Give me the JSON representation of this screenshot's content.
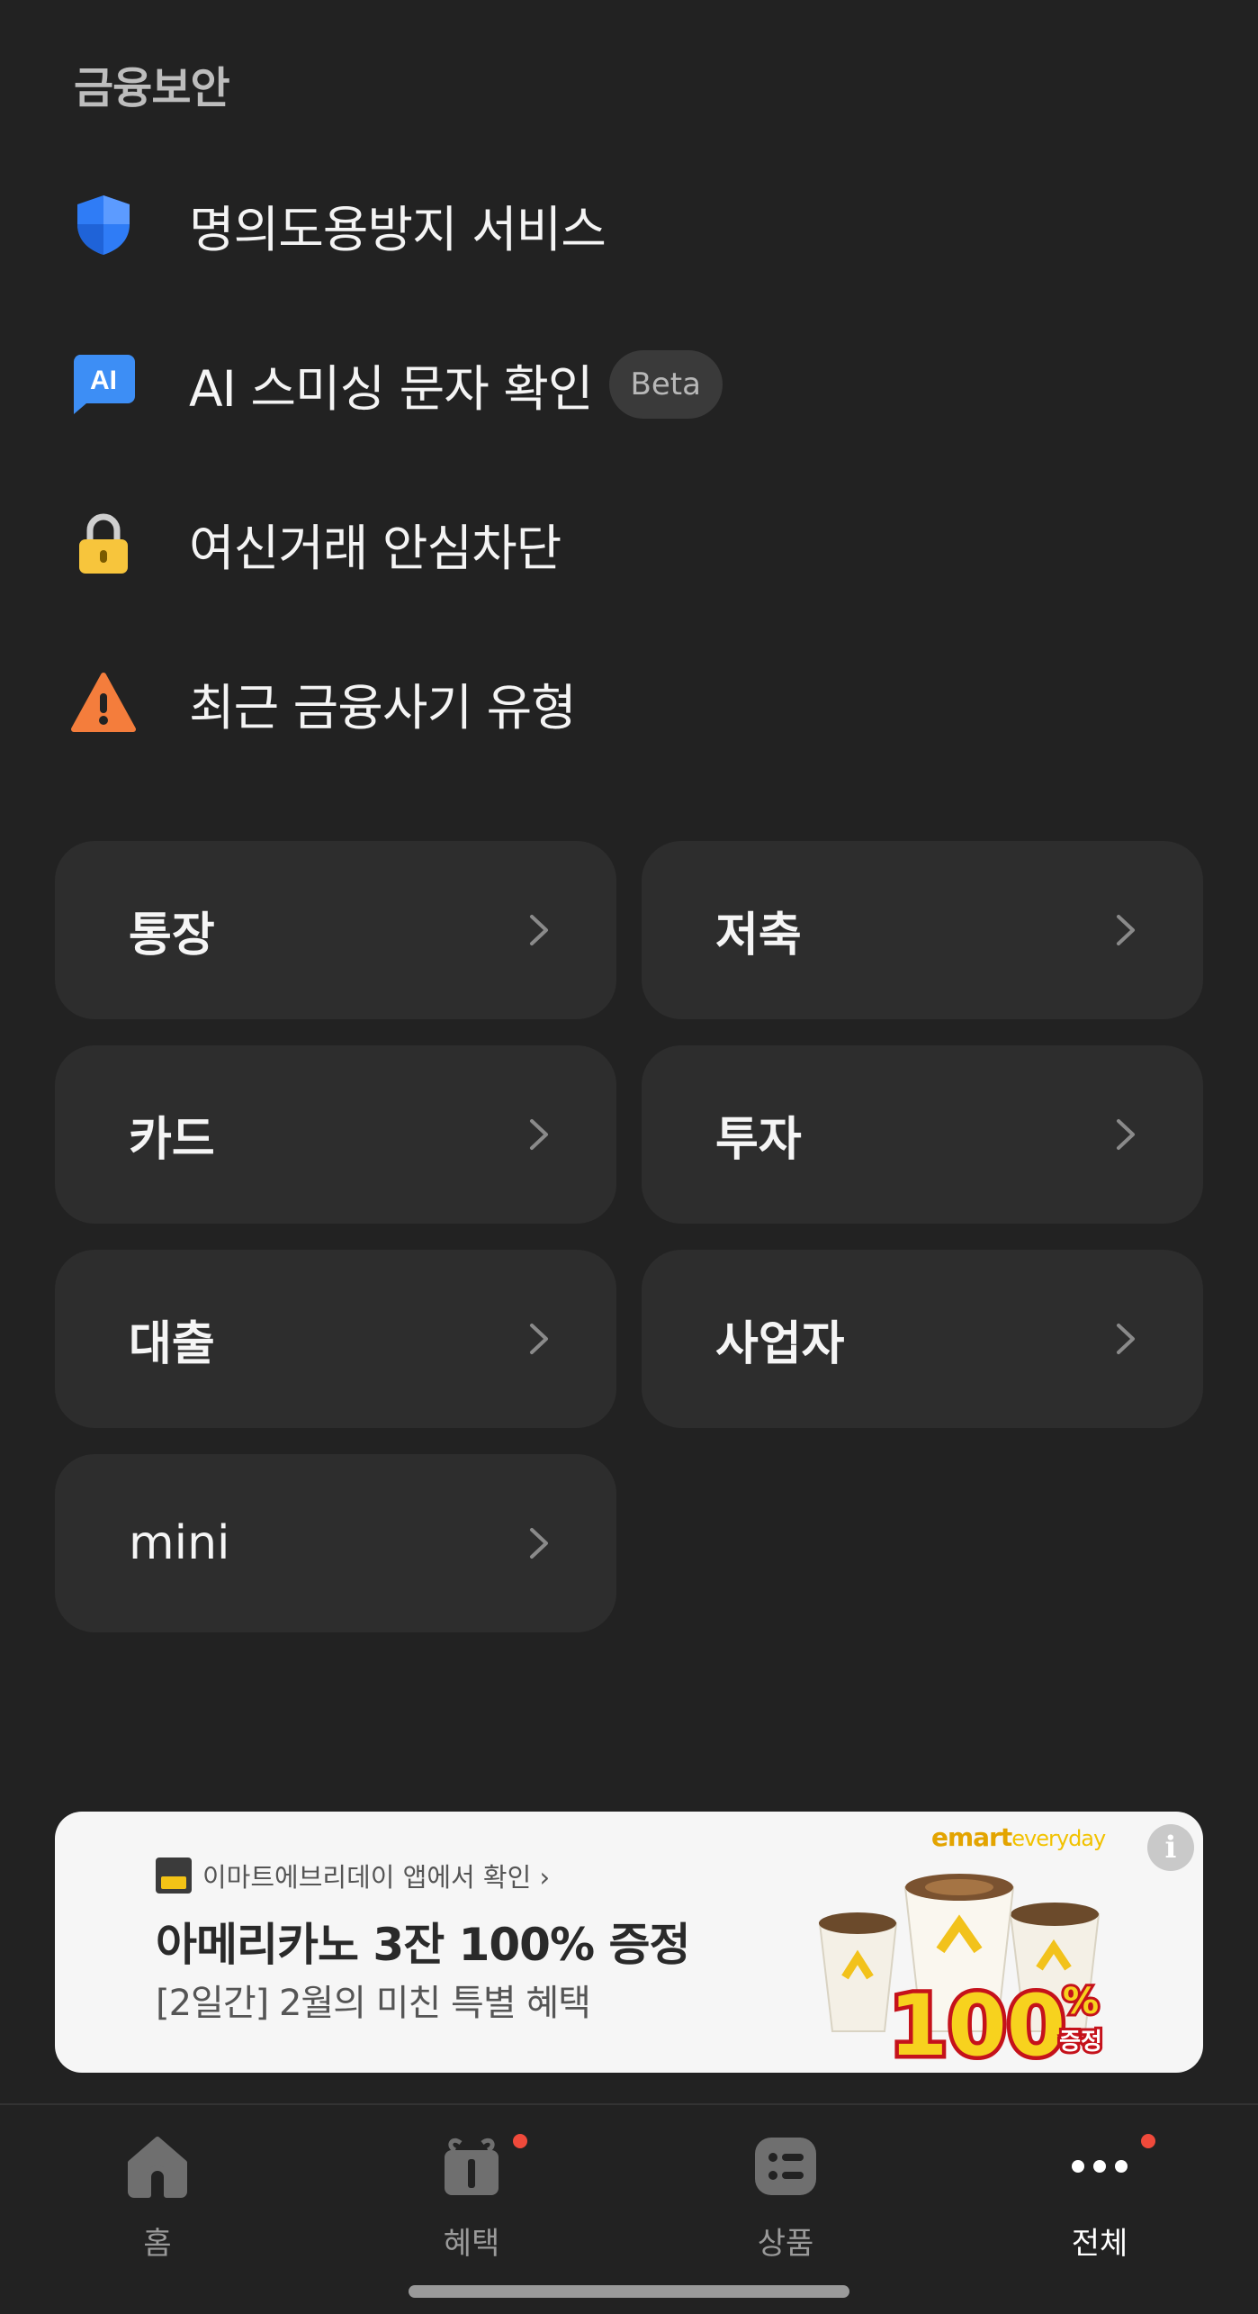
{
  "section": {
    "title": "금융보안"
  },
  "security_items": [
    {
      "label": "명의도용방지 서비스",
      "icon": "shield-icon"
    },
    {
      "label": "AI 스미싱 문자 확인",
      "icon": "ai-chat-icon",
      "badge": "Beta"
    },
    {
      "label": "여신거래 안심차단",
      "icon": "lock-icon"
    },
    {
      "label": "최근 금융사기 유형",
      "icon": "warning-icon"
    }
  ],
  "categories": [
    {
      "label": "통장"
    },
    {
      "label": "저축"
    },
    {
      "label": "카드"
    },
    {
      "label": "투자"
    },
    {
      "label": "대출"
    },
    {
      "label": "사업자"
    },
    {
      "label": "mini"
    }
  ],
  "ad": {
    "source": "이마트에브리데이 앱에서 확인 ›",
    "headline": "아메리카노 3잔 100% 증정",
    "subtext": "[2일간] 2월의 미친 특별 혜택",
    "brand": "emart",
    "brand_suffix": "everyday",
    "promo_number": "100",
    "promo_percent": "%",
    "promo_word": "증정",
    "info_symbol": "i"
  },
  "tabs": [
    {
      "label": "홈",
      "icon": "home-icon",
      "active": false,
      "dot": false
    },
    {
      "label": "혜택",
      "icon": "gift-icon",
      "active": false,
      "dot": true
    },
    {
      "label": "상품",
      "icon": "list-icon",
      "active": false,
      "dot": false
    },
    {
      "label": "전체",
      "icon": "more-icon",
      "active": true,
      "dot": true
    }
  ],
  "colors": {
    "background": "#222222",
    "card": "#2d2d2d",
    "shield": "#2f7cf6",
    "ai_badge": "#3d8ef5",
    "lock": "#f7c53c",
    "warning": "#f47d3c",
    "notification_dot": "#f04a3b"
  }
}
